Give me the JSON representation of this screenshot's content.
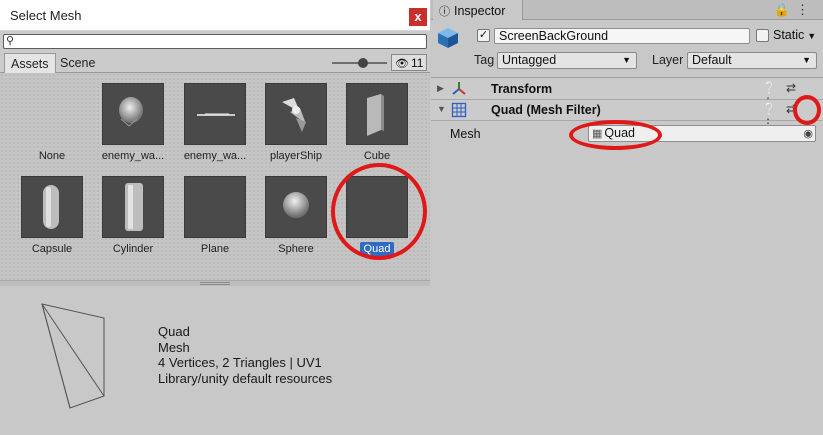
{
  "select_window": {
    "title": "Select Mesh",
    "close_label": "x",
    "search": {
      "value": "",
      "placeholder": ""
    },
    "tabs": [
      {
        "label": "Assets"
      },
      {
        "label": "Scene"
      }
    ],
    "hidden_count": "11",
    "items": [
      {
        "label": "None",
        "has_thumb": false
      },
      {
        "label": "enemy_wa...",
        "has_thumb": true
      },
      {
        "label": "enemy_wa...",
        "has_thumb": true
      },
      {
        "label": "playerShip",
        "has_thumb": true
      },
      {
        "label": "Cube",
        "has_thumb": true
      },
      {
        "label": "Capsule",
        "has_thumb": true
      },
      {
        "label": "Cylinder",
        "has_thumb": true
      },
      {
        "label": "Plane",
        "has_thumb": true
      },
      {
        "label": "Sphere",
        "has_thumb": true
      },
      {
        "label": "Quad",
        "has_thumb": true,
        "selected": true
      }
    ],
    "preview_info": {
      "name": "Quad",
      "type": "Mesh",
      "stats": "4 Vertices, 2 Triangles | UV1",
      "path": "Library/unity default resources"
    }
  },
  "inspector": {
    "tab_label": "Inspector",
    "object_name": "ScreenBackGround",
    "active": true,
    "static_label": "Static",
    "tag_label": "Tag",
    "tag_value": "Untagged",
    "layer_label": "Layer",
    "layer_value": "Default",
    "components": [
      {
        "title": "Transform",
        "expanded": false
      },
      {
        "title": "Quad (Mesh Filter)",
        "expanded": true
      }
    ],
    "mesh_field": {
      "label": "Mesh",
      "value": "Quad"
    }
  },
  "colors": {
    "highlight_ring": "#e01818",
    "selection_blue": "#2f6bc0",
    "close_red": "#c9302c"
  }
}
